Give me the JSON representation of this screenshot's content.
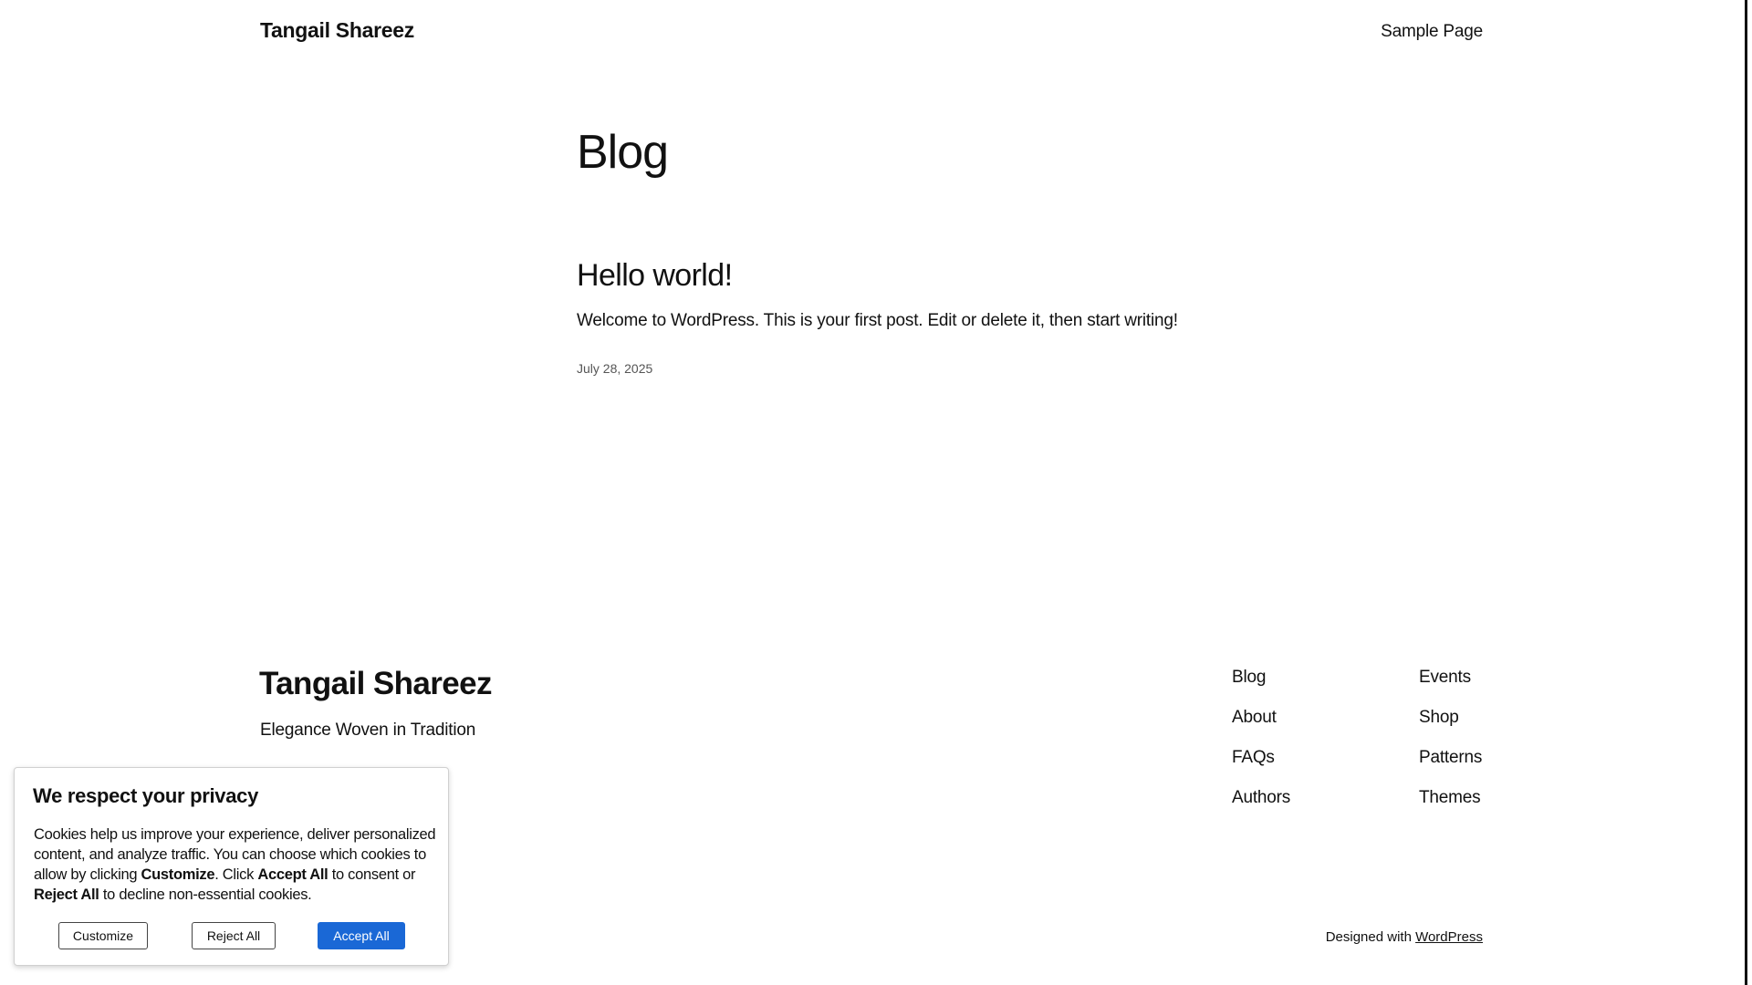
{
  "header": {
    "site_title": "Tangail Shareez",
    "nav": [
      "Sample Page"
    ]
  },
  "main": {
    "page_title": "Blog",
    "posts": [
      {
        "title": "Hello world!",
        "excerpt": "Welcome to WordPress. This is your first post. Edit or delete it, then start writing!",
        "date": "July 28, 2025"
      }
    ]
  },
  "footer": {
    "site_title": "Tangail Shareez",
    "tagline": "Elegance Woven in Tradition",
    "nav_col_1": [
      "Blog",
      "About",
      "FAQs",
      "Authors"
    ],
    "nav_col_2": [
      "Events",
      "Shop",
      "Patterns",
      "Themes"
    ],
    "credit_prefix": "Designed with",
    "credit_link": "WordPress"
  },
  "cookie_banner": {
    "title": "We respect your privacy",
    "text_1": "Cookies help us improve your experience, deliver personalized content, and analyze traffic. You can choose which cookies to allow by clicking",
    "bold_customize": "Customize",
    "text_2": ". Click",
    "bold_accept": "Accept All",
    "text_3": "to consent or",
    "bold_reject": "Reject All",
    "text_4": "to decline non-essential cookies.",
    "buttons": {
      "customize": "Customize",
      "reject": "Reject All",
      "accept": "Accept All"
    },
    "accent_color": "#1a68d6"
  }
}
